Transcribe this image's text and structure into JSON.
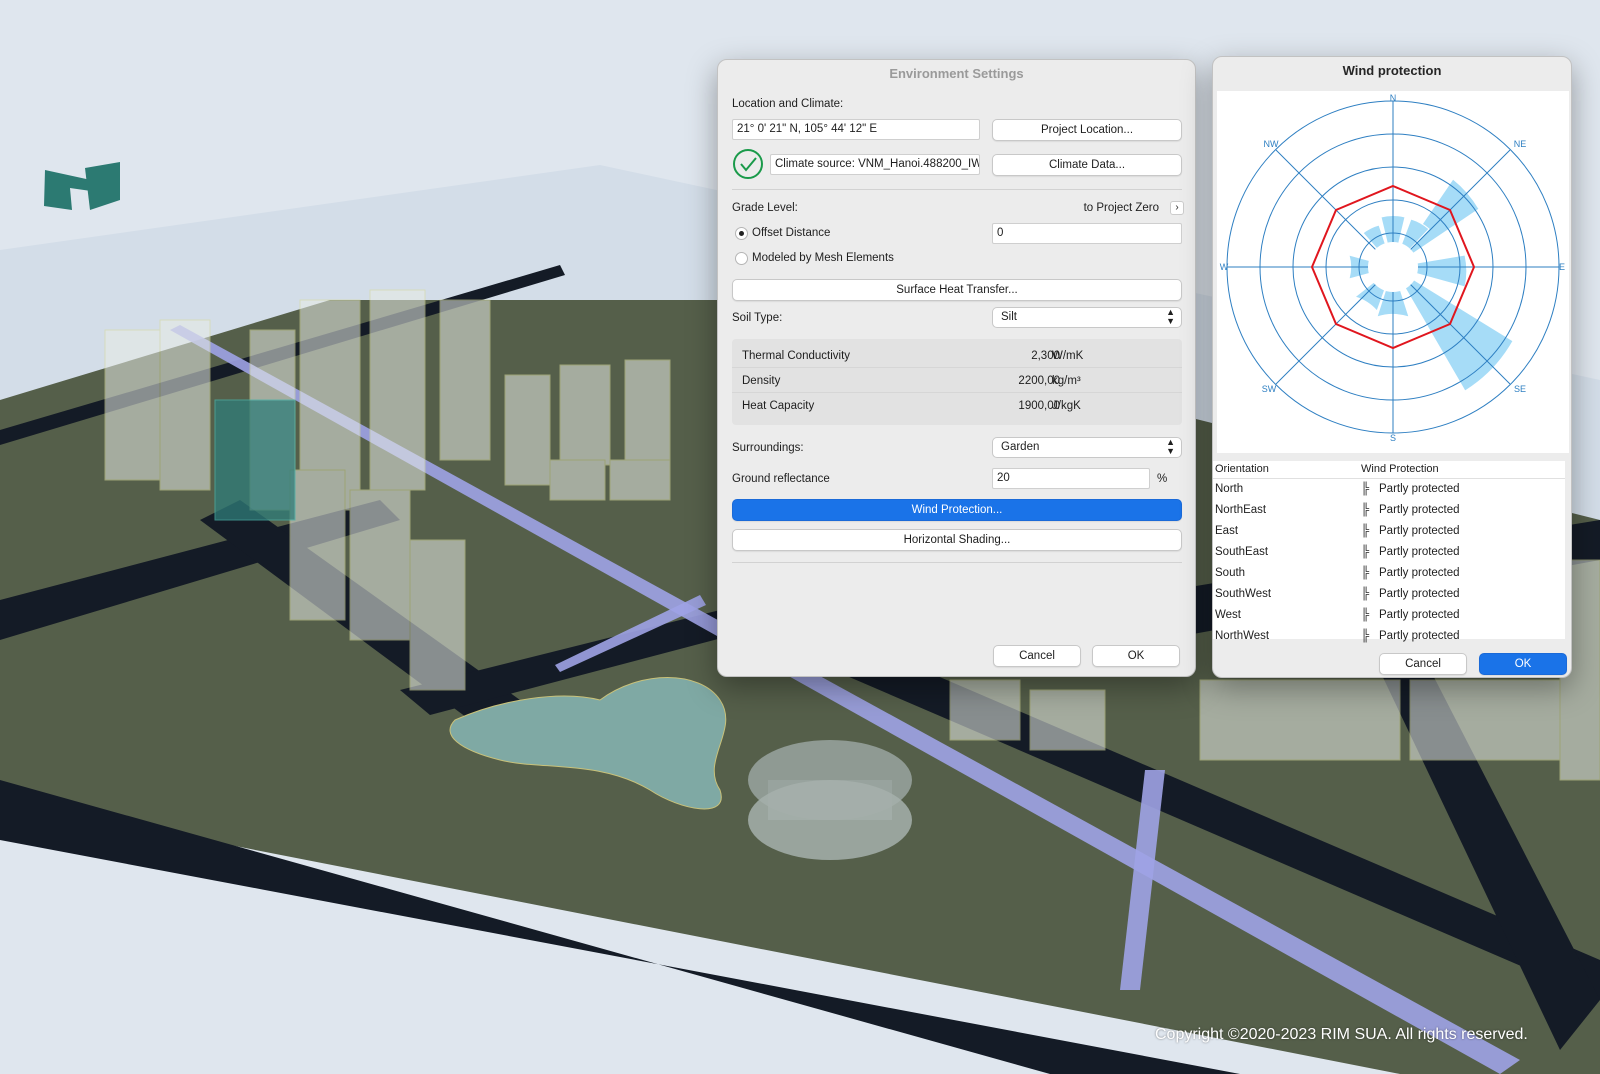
{
  "copyright": "Copyright ©2020-2023 RIM SUA. All rights reserved.",
  "env_dialog": {
    "title": "Environment Settings",
    "location_label": "Location and Climate:",
    "coordinates": "21° 0' 21\" N, 105° 44' 12\" E",
    "project_location_btn": "Project Location...",
    "climate_source": "Climate source: VNM_Hanoi.488200_IW",
    "climate_data_btn": "Climate Data...",
    "grade_level_label": "Grade Level:",
    "grade_reference": "to Project Zero",
    "offset_distance_label": "Offset Distance",
    "offset_distance_value": "0",
    "modeled_by_mesh_label": "Modeled by Mesh Elements",
    "surface_heat_btn": "Surface Heat Transfer...",
    "soil_type_label": "Soil Type:",
    "soil_type_value": "Silt",
    "soil_props": [
      {
        "name": "Thermal Conductivity",
        "value": "2,300",
        "unit": "W/mK"
      },
      {
        "name": "Density",
        "value": "2200,00",
        "unit": "kg/m³"
      },
      {
        "name": "Heat Capacity",
        "value": "1900,00",
        "unit": "J/kgK"
      }
    ],
    "surroundings_label": "Surroundings:",
    "surroundings_value": "Garden",
    "ground_reflectance_label": "Ground reflectance",
    "ground_reflectance_value": "20",
    "ground_reflectance_unit": "%",
    "wind_protection_btn": "Wind Protection...",
    "horizontal_shading_btn": "Horizontal Shading...",
    "cancel_btn": "Cancel",
    "ok_btn": "OK"
  },
  "wind_dialog": {
    "title": "Wind protection",
    "compass": {
      "N": "N",
      "NE": "NE",
      "E": "E",
      "SE": "SE",
      "S": "S",
      "SW": "SW",
      "W": "W",
      "NW": "NW"
    },
    "column_orientation": "Orientation",
    "column_protection": "Wind Protection",
    "rows": [
      {
        "orientation": "North",
        "protection": "Partly protected"
      },
      {
        "orientation": "NorthEast",
        "protection": "Partly protected"
      },
      {
        "orientation": "East",
        "protection": "Partly protected"
      },
      {
        "orientation": "SouthEast",
        "protection": "Partly protected"
      },
      {
        "orientation": "South",
        "protection": "Partly protected"
      },
      {
        "orientation": "SouthWest",
        "protection": "Partly protected"
      },
      {
        "orientation": "West",
        "protection": "Partly protected"
      },
      {
        "orientation": "NorthWest",
        "protection": "Partly protected"
      }
    ],
    "cancel_btn": "Cancel",
    "ok_btn": "OK"
  },
  "colors": {
    "accent": "#1a73e8",
    "ground": "#555f4a",
    "road": "#141b26",
    "water": "#7fa9a4",
    "rose_fill": "#a6dcf7",
    "rose_grid": "#2e7fc2",
    "rose_ring": "#e0161e",
    "check": "#1a9a4a"
  }
}
